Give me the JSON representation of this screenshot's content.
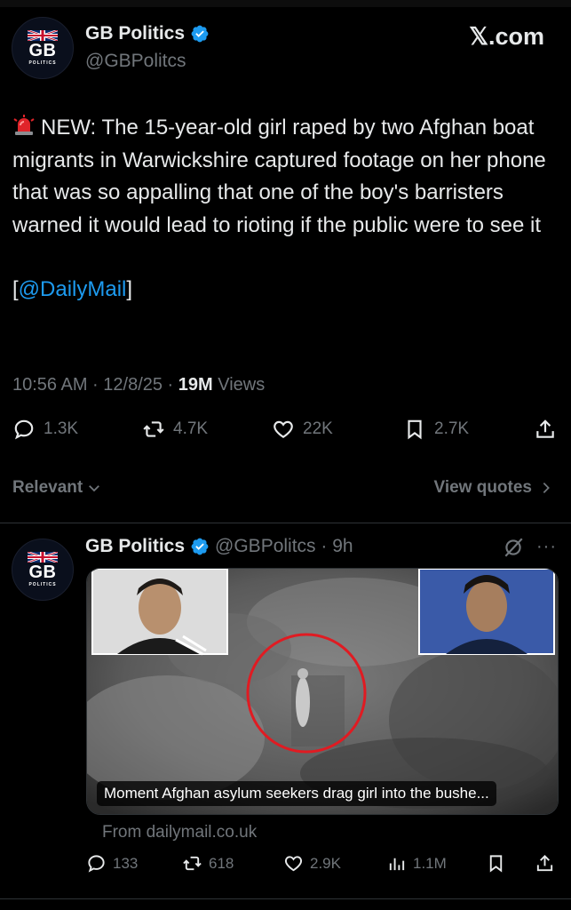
{
  "author": {
    "name": "GB Politics",
    "handle": "@GBPolitcs",
    "avatar_text": "GB",
    "avatar_sub": "POLITICS",
    "verified": true
  },
  "brand": "𝕏.com",
  "tweet": {
    "text": "NEW: The 15-year-old girl raped by two Afghan boat migrants in Warwickshire captured footage on her phone that was so appalling that one of the boy's barristers warned it would lead to rioting if the public were to see it",
    "link_open": "[",
    "link_text": "@DailyMail",
    "link_close": "]",
    "time": "10:56 AM · 12/8/25 · ",
    "views_count": "19M",
    "views_label": " Views",
    "replies": "1.3K",
    "reposts": "4.7K",
    "likes": "22K",
    "bookmarks": "2.7K"
  },
  "sort": {
    "label": "Relevant",
    "quotes_label": "View quotes"
  },
  "reply": {
    "name": "GB Politics",
    "handle_time": "@GBPolitcs · 9h",
    "card_caption": "Moment Afghan asylum seekers drag girl into the bushe...",
    "source": "From dailymail.co.uk",
    "replies": "133",
    "reposts": "618",
    "likes": "2.9K",
    "views": "1.1M"
  },
  "colors": {
    "background": "#000000",
    "text": "#e7e9ea",
    "muted": "#71767b",
    "link": "#1d9bf0",
    "verified": "#1d9bf0"
  }
}
